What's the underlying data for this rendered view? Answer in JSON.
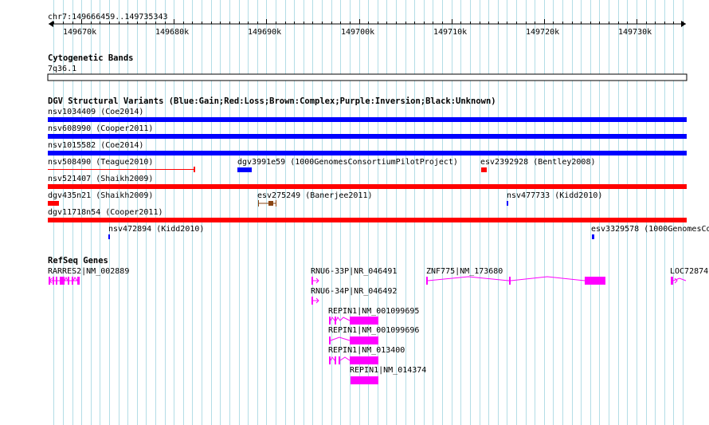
{
  "colors": {
    "gain": "#0000ff",
    "loss": "#ff0000",
    "complex": "#8b4513",
    "gene": "#ff00ff",
    "gridline": "#b3dde6",
    "text": "#000000",
    "background": "#ffffff"
  },
  "ruler": {
    "label": "chr7:149666459..149735343",
    "start": 149666459,
    "end": 149735343,
    "ticks": [
      "149670k",
      "149680k",
      "149690k",
      "149700k",
      "149710k",
      "149720k",
      "149730k"
    ]
  },
  "cytoband": {
    "title": "Cytogenetic Bands",
    "band": "7q36.1"
  },
  "dgv": {
    "title": "DGV Structural Variants (Blue:Gain;Red:Loss;Brown:Complex;Purple:Inversion;Black:Unknown)",
    "variants": [
      {
        "label": "nsv1034409 (Coe2014)",
        "type": "gain",
        "start": 149666459,
        "end": 149735343
      },
      {
        "label": "nsv608990 (Cooper2011)",
        "type": "gain",
        "start": 149666459,
        "end": 149735343
      },
      {
        "label": "nsv1015582 (Coe2014)",
        "type": "gain",
        "start": 149666459,
        "end": 149735343
      },
      {
        "label": "nsv508490 (Teague2010)",
        "type": "loss",
        "start": 149666459,
        "end": 149682300
      },
      {
        "label": "dgv3991e59 (1000GenomesConsortiumPilotProject)",
        "type": "gain",
        "start": 149686800,
        "end": 149688400
      },
      {
        "label": "esv2392928 (Bentley2008)",
        "type": "loss",
        "start": 149713300,
        "end": 149713900
      },
      {
        "label": "nsv521407 (Shaikh2009)",
        "type": "loss",
        "start": 149666459,
        "end": 149735343
      },
      {
        "label": "dgv435n21 (Shaikh2009)",
        "type": "loss",
        "start": 149666459,
        "end": 149667600
      },
      {
        "label": "esv275249 (Banerjee2011)",
        "type": "complex",
        "start": 149689200,
        "end": 149691200
      },
      {
        "label": "nsv477733 (Kidd2010)",
        "type": "gain",
        "start": 149716500,
        "end": 149716700
      },
      {
        "label": "dgv11718n54 (Cooper2011)",
        "type": "loss",
        "start": 149666459,
        "end": 149735343
      },
      {
        "label": "nsv472894 (Kidd2010)",
        "type": "gain",
        "start": 149672700,
        "end": 149672900
      },
      {
        "label": "esv3329578 (1000GenomesCo",
        "type": "gain",
        "start": 149725600,
        "end": 149725900
      }
    ]
  },
  "refseq": {
    "title": "RefSeq Genes",
    "genes": [
      {
        "label": "RARRES2|NM_002889"
      },
      {
        "label": "RNU6-33P|NR_046491"
      },
      {
        "label": "ZNF775|NM_173680"
      },
      {
        "label": "LOC72874"
      },
      {
        "label": "RNU6-34P|NR_046492"
      },
      {
        "label": "REPIN1|NM_001099695"
      },
      {
        "label": "REPIN1|NM_001099696"
      },
      {
        "label": "REPIN1|NM_013400"
      },
      {
        "label": "REPIN1|NM_014374"
      }
    ]
  }
}
